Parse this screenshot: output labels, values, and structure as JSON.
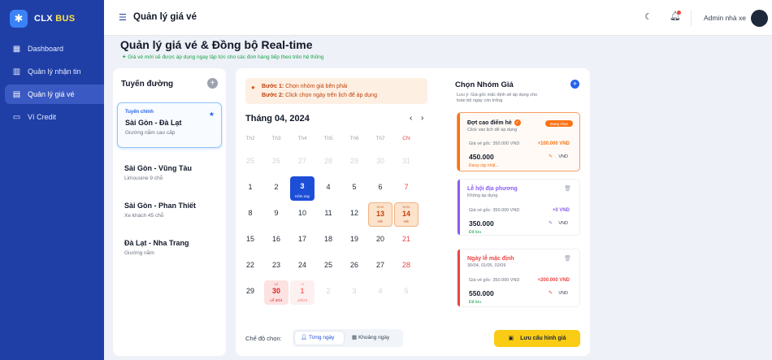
{
  "brand": {
    "name": "CLX",
    "accent": "BUS"
  },
  "nav": [
    {
      "label": "Dashboard",
      "icon": "dashboard-icon",
      "active": false
    },
    {
      "label": "Quản lý nhận tin",
      "icon": "chart-icon",
      "active": false
    },
    {
      "label": "Quản lý giá vé",
      "icon": "ticket-icon",
      "active": true
    },
    {
      "label": "Ví Credit",
      "icon": "wallet-icon",
      "active": false
    }
  ],
  "topbar": {
    "title": "Quản lý giá vé",
    "admin": "Admin nhà xe"
  },
  "page": {
    "title": "Quản lý giá vé & Đồng bộ Real-time",
    "subtitle": "✦ Giá vé mới sẽ được áp dụng ngay lập tức cho các đơn hàng tiếp theo trên hệ thống"
  },
  "routes": {
    "title": "Tuyến đường",
    "items": [
      {
        "tag": "Tuyến chính",
        "name": "Sài Gòn - Đà Lạt",
        "type": "Giường nằm cao cấp",
        "active": true
      },
      {
        "tag": "",
        "name": "Sài Gòn - Vũng Tàu",
        "type": "Limousine 9 chỗ",
        "active": false
      },
      {
        "tag": "",
        "name": "Sài Gòn - Phan Thiết",
        "type": "Xe khách 45 chỗ",
        "active": false
      },
      {
        "tag": "",
        "name": "Đà Lạt - Nha Trang",
        "type": "Giường nằm",
        "active": false
      }
    ]
  },
  "hint": {
    "step1_label": "Bước 1:",
    "step1_text": "Chọn nhóm giá bên phải",
    "step2_label": "Bước 2:",
    "step2_text": "Click chọn ngày trên lịch để áp dụng"
  },
  "calendar": {
    "month": "Tháng 04, 2024",
    "weekdays": [
      "Th2",
      "Th3",
      "Th4",
      "Th5",
      "Th6",
      "Th7",
      "CN"
    ],
    "weeks": [
      [
        {
          "d": "25",
          "k": "muted"
        },
        {
          "d": "26",
          "k": "muted"
        },
        {
          "d": "27",
          "k": "muted"
        },
        {
          "d": "28",
          "k": "muted"
        },
        {
          "d": "29",
          "k": "muted"
        },
        {
          "d": "30",
          "k": "muted"
        },
        {
          "d": "31",
          "k": "muted"
        }
      ],
      [
        {
          "d": "1"
        },
        {
          "d": "2"
        },
        {
          "d": "3",
          "k": "today",
          "mini": "Hôm nay"
        },
        {
          "d": "4"
        },
        {
          "d": "5"
        },
        {
          "d": "6"
        },
        {
          "d": "7",
          "k": "sun"
        }
      ],
      [
        {
          "d": "8"
        },
        {
          "d": "9"
        },
        {
          "d": "10"
        },
        {
          "d": "11"
        },
        {
          "d": "12"
        },
        {
          "d": "13",
          "k": "tag",
          "top": "ĐCĐ",
          "mini": "Hè"
        },
        {
          "d": "14",
          "k": "tag",
          "top": "ĐCĐ",
          "mini": "Hè"
        }
      ],
      [
        {
          "d": "15"
        },
        {
          "d": "16"
        },
        {
          "d": "17"
        },
        {
          "d": "18"
        },
        {
          "d": "19"
        },
        {
          "d": "20"
        },
        {
          "d": "21"
        }
      ],
      [
        {
          "d": "22"
        },
        {
          "d": "23"
        },
        {
          "d": "24"
        },
        {
          "d": "25"
        },
        {
          "d": "26"
        },
        {
          "d": "27"
        },
        {
          "d": "28",
          "k": "sun"
        }
      ],
      [
        {
          "d": "29"
        },
        {
          "d": "30",
          "k": "holiday",
          "top": "Lễ",
          "mini": "Lễ 30/4"
        },
        {
          "d": "1",
          "k": "holiday soft",
          "top": "Lễ",
          "mini": "1/5/24"
        },
        {
          "d": "2",
          "k": "muted"
        },
        {
          "d": "3",
          "k": "muted"
        },
        {
          "d": "4",
          "k": "muted"
        },
        {
          "d": "5",
          "k": "muted"
        }
      ]
    ]
  },
  "mode": {
    "label": "Chế độ chọn:",
    "single": "Từng ngày",
    "range": "Khoảng ngày"
  },
  "groups": {
    "title": "Chọn Nhóm Giá",
    "note": "Lưu ý: Giá gốc mặc định sẽ áp dụng cho toàn bộ ngày còn trống",
    "items": [
      {
        "name": "Đợt cao điểm hè",
        "desc": "Click vào lịch để áp dụng",
        "badge": "Đang chọn",
        "base": "Giá vé gốc: 350.000 VND",
        "delta": "+100.000 VND",
        "price": "450.000",
        "currency": "VND",
        "status": "Đang cập nhật...",
        "color": "#f97316",
        "selected": true
      },
      {
        "name": "Lễ hội địa phương",
        "desc": "Không áp dụng",
        "badge": "",
        "base": "Giá vé gốc: 350.000 VND",
        "delta": "+0 VND",
        "price": "350.000",
        "currency": "VND",
        "status": "Đã lưu",
        "color": "#8b5cf6",
        "selected": false
      },
      {
        "name": "Ngày lễ mặc định",
        "desc": "30/04, 01/05, 02/09",
        "badge": "",
        "base": "Giá vé gốc: 350.000 VND",
        "delta": "+200.000 VND",
        "price": "550.000",
        "currency": "VND",
        "status": "Đã lưu",
        "color": "#ef4444",
        "selected": false
      }
    ]
  },
  "save_label": "Lưu cấu hình giá",
  "colors": {
    "sidebar": "#1f3fa6",
    "primary": "#1d4ed8",
    "accent": "#f97316",
    "save": "#facc15"
  }
}
